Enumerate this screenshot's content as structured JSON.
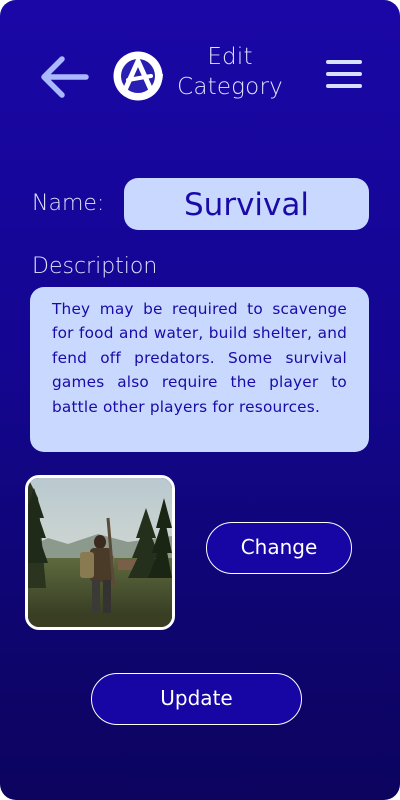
{
  "header": {
    "title_line1": "Edit",
    "title_line2": "Category",
    "back_icon": "arrow-left-icon",
    "logo_icon": "app-logo-icon",
    "menu_icon": "hamburger-menu-icon"
  },
  "form": {
    "name_label": "Name:",
    "name_value": "Survival",
    "description_label": "Description",
    "description_value": "They may be required  to scavenge for food and water, build shelter, and fend off predators.  Some survival games also require the player to battle other players for resources."
  },
  "image": {
    "change_button": "Change"
  },
  "actions": {
    "update_button": "Update"
  },
  "colors": {
    "background_top": "#1a07a6",
    "background_bottom": "#0c045e",
    "field_background": "#c9d8ff",
    "field_text": "#1a0aa8",
    "label_text": "#dfe6ff",
    "button_background": "#1705a4"
  }
}
